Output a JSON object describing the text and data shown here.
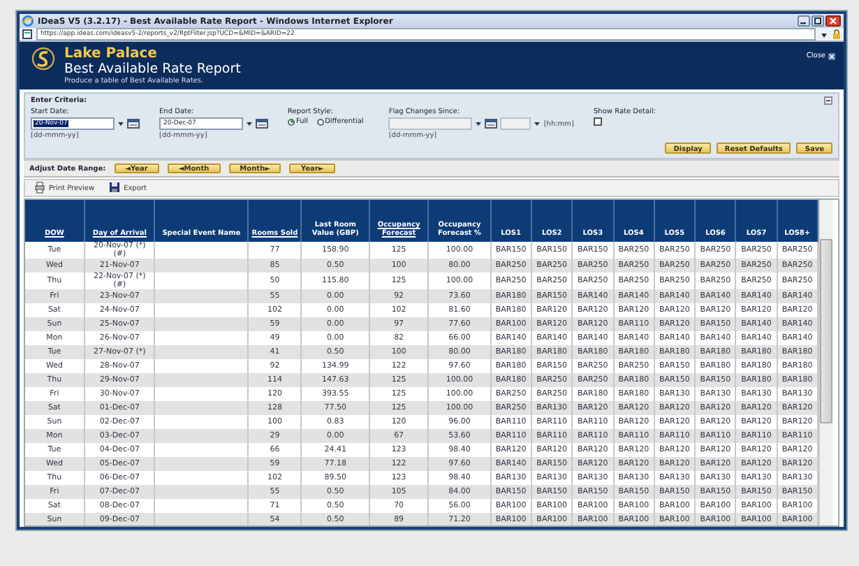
{
  "window": {
    "title": "IDeaS V5 (3.2.17) - Best Available Rate Report - Windows Internet Explorer",
    "address": "https://app.ideas.com/ideasv5-2/reports_v2/RptFilter.jsp?UCD=&MID=&ARID=22"
  },
  "header": {
    "property": "Lake Palace",
    "report": "Best Available Rate Report",
    "description": "Produce a table of Best Available Rates.",
    "close": "Close"
  },
  "criteria": {
    "title": "Enter Criteria:",
    "start_date": {
      "label": "Start Date:",
      "value": "20-Nov-07",
      "hint": "[dd-mmm-yy]"
    },
    "end_date": {
      "label": "End Date:",
      "value": "20-Dec-07",
      "hint": "[dd-mmm-yy]"
    },
    "report_style": {
      "label": "Report Style:",
      "options": [
        {
          "label": "Full",
          "selected": true
        },
        {
          "label": "Differential",
          "selected": false
        }
      ]
    },
    "flag_changes": {
      "label": "Flag Changes Since:",
      "disabled": true,
      "hint": "[dd-mmm-yy]",
      "time_hint": "[hh:mm]"
    },
    "show_rate_detail": {
      "label": "Show Rate Detail:",
      "checked": false
    },
    "buttons": [
      "Display",
      "Reset Defaults",
      "Save"
    ]
  },
  "date_range": {
    "label": "Adjust Date Range:",
    "buttons": [
      "◄Year",
      "◄Month",
      "Month►",
      "Year►"
    ]
  },
  "toolbar": [
    {
      "label": "Print Preview",
      "kind": "print"
    },
    {
      "label": "Export",
      "kind": "export"
    }
  ],
  "table": {
    "columns": [
      {
        "label": "DOW",
        "sortable": true
      },
      {
        "label": "Day of Arrival",
        "sortable": true
      },
      {
        "label": "Special Event Name",
        "sortable": false
      },
      {
        "label": "Rooms Sold",
        "sortable": true
      },
      {
        "label": "Last Room Value (GBP)",
        "sortable": false
      },
      {
        "label": "Occupancy Forecast",
        "sortable": true
      },
      {
        "label": "Occupancy Forecast %",
        "sortable": false
      },
      {
        "label": "LOS1",
        "sortable": false
      },
      {
        "label": "LOS2",
        "sortable": false
      },
      {
        "label": "LOS3",
        "sortable": false
      },
      {
        "label": "LOS4",
        "sortable": false
      },
      {
        "label": "LOS5",
        "sortable": false
      },
      {
        "label": "LOS6",
        "sortable": false
      },
      {
        "label": "LOS7",
        "sortable": false
      },
      {
        "label": "LOS8+",
        "sortable": false
      }
    ],
    "rows": [
      [
        "Tue",
        "20-Nov-07 (*) (#)",
        "",
        "77",
        "158.90",
        "125",
        "100.00",
        "BAR150",
        "BAR150",
        "BAR150",
        "BAR250",
        "BAR250",
        "BAR250",
        "BAR250",
        "BAR250"
      ],
      [
        "Wed",
        "21-Nov-07",
        "",
        "85",
        "0.50",
        "100",
        "80.00",
        "BAR250",
        "BAR250",
        "BAR250",
        "BAR250",
        "BAR250",
        "BAR250",
        "BAR250",
        "BAR250"
      ],
      [
        "Thu",
        "22-Nov-07 (*) (#)",
        "",
        "50",
        "115.80",
        "125",
        "100.00",
        "BAR250",
        "BAR250",
        "BAR250",
        "BAR250",
        "BAR250",
        "BAR250",
        "BAR250",
        "BAR250"
      ],
      [
        "Fri",
        "23-Nov-07",
        "",
        "55",
        "0.00",
        "92",
        "73.60",
        "BAR180",
        "BAR150",
        "BAR140",
        "BAR140",
        "BAR140",
        "BAR140",
        "BAR140",
        "BAR140"
      ],
      [
        "Sat",
        "24-Nov-07",
        "",
        "102",
        "0.00",
        "102",
        "81.60",
        "BAR180",
        "BAR120",
        "BAR120",
        "BAR120",
        "BAR120",
        "BAR120",
        "BAR120",
        "BAR120"
      ],
      [
        "Sun",
        "25-Nov-07",
        "",
        "59",
        "0.00",
        "97",
        "77.60",
        "BAR100",
        "BAR120",
        "BAR120",
        "BAR110",
        "BAR120",
        "BAR150",
        "BAR140",
        "BAR140"
      ],
      [
        "Mon",
        "26-Nov-07",
        "",
        "49",
        "0.00",
        "82",
        "66.00",
        "BAR140",
        "BAR140",
        "BAR140",
        "BAR140",
        "BAR140",
        "BAR140",
        "BAR140",
        "BAR140"
      ],
      [
        "Tue",
        "27-Nov-07 (*)",
        "",
        "41",
        "0.50",
        "100",
        "80.00",
        "BAR180",
        "BAR180",
        "BAR180",
        "BAR180",
        "BAR180",
        "BAR180",
        "BAR180",
        "BAR180"
      ],
      [
        "Wed",
        "28-Nov-07",
        "",
        "92",
        "134.99",
        "122",
        "97.60",
        "BAR180",
        "BAR150",
        "BAR250",
        "BAR250",
        "BAR150",
        "BAR180",
        "BAR180",
        "BAR180"
      ],
      [
        "Thu",
        "29-Nov-07",
        "",
        "114",
        "147.63",
        "125",
        "100.00",
        "BAR180",
        "BAR250",
        "BAR250",
        "BAR180",
        "BAR150",
        "BAR150",
        "BAR180",
        "BAR180"
      ],
      [
        "Fri",
        "30-Nov-07",
        "",
        "120",
        "393.55",
        "125",
        "100.00",
        "BAR250",
        "BAR250",
        "BAR180",
        "BAR180",
        "BAR130",
        "BAR130",
        "BAR130",
        "BAR130"
      ],
      [
        "Sat",
        "01-Dec-07",
        "",
        "128",
        "77.50",
        "125",
        "100.00",
        "BAR250",
        "BAR130",
        "BAR120",
        "BAR120",
        "BAR120",
        "BAR120",
        "BAR120",
        "BAR120"
      ],
      [
        "Sun",
        "02-Dec-07",
        "",
        "100",
        "0.83",
        "120",
        "96.00",
        "BAR110",
        "BAR110",
        "BAR110",
        "BAR120",
        "BAR120",
        "BAR120",
        "BAR120",
        "BAR120"
      ],
      [
        "Mon",
        "03-Dec-07",
        "",
        "29",
        "0.00",
        "67",
        "53.60",
        "BAR110",
        "BAR110",
        "BAR110",
        "BAR110",
        "BAR110",
        "BAR110",
        "BAR110",
        "BAR110"
      ],
      [
        "Tue",
        "04-Dec-07",
        "",
        "66",
        "24.41",
        "123",
        "98.40",
        "BAR120",
        "BAR120",
        "BAR120",
        "BAR120",
        "BAR120",
        "BAR120",
        "BAR120",
        "BAR120"
      ],
      [
        "Wed",
        "05-Dec-07",
        "",
        "59",
        "77.18",
        "122",
        "97.60",
        "BAR140",
        "BAR150",
        "BAR120",
        "BAR120",
        "BAR120",
        "BAR120",
        "BAR120",
        "BAR120"
      ],
      [
        "Thu",
        "06-Dec-07",
        "",
        "102",
        "89.50",
        "123",
        "98.40",
        "BAR130",
        "BAR130",
        "BAR130",
        "BAR130",
        "BAR130",
        "BAR130",
        "BAR130",
        "BAR130"
      ],
      [
        "Fri",
        "07-Dec-07",
        "",
        "55",
        "0.50",
        "105",
        "84.00",
        "BAR150",
        "BAR150",
        "BAR150",
        "BAR150",
        "BAR150",
        "BAR150",
        "BAR150",
        "BAR150"
      ],
      [
        "Sat",
        "08-Dec-07",
        "",
        "71",
        "0.50",
        "70",
        "56.00",
        "BAR100",
        "BAR100",
        "BAR100",
        "BAR100",
        "BAR100",
        "BAR100",
        "BAR100",
        "BAR100"
      ],
      [
        "Sun",
        "09-Dec-07",
        "",
        "54",
        "0.50",
        "89",
        "71.20",
        "BAR100",
        "BAR100",
        "BAR100",
        "BAR100",
        "BAR100",
        "BAR100",
        "BAR100",
        "BAR100"
      ]
    ]
  }
}
